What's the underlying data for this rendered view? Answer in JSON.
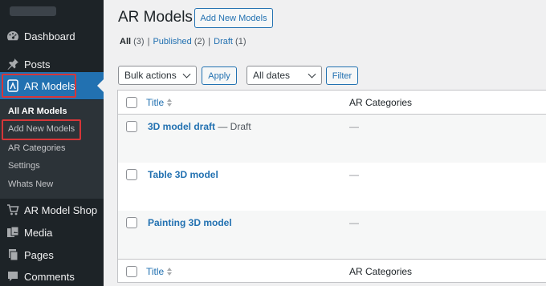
{
  "sidebar": {
    "items": [
      {
        "label": "Dashboard",
        "icon": "dashboard-icon"
      },
      {
        "label": "Posts",
        "icon": "pushpin-icon"
      },
      {
        "label": "AR Models",
        "icon": "ar-model-icon"
      },
      {
        "label": "AR Model Shop",
        "icon": "cart-icon"
      },
      {
        "label": "Media",
        "icon": "media-icon"
      },
      {
        "label": "Pages",
        "icon": "pages-icon"
      },
      {
        "label": "Comments",
        "icon": "comments-icon"
      }
    ],
    "submenu": [
      "All AR Models",
      "Add New Models",
      "AR Categories",
      "Settings",
      "Whats New"
    ]
  },
  "header": {
    "title": "AR Models",
    "add_new_label": "Add New Models"
  },
  "views": {
    "all_label": "All",
    "all_count": "(3)",
    "published_label": "Published",
    "published_count": "(2)",
    "draft_label": "Draft",
    "draft_count": "(1)",
    "separator": "|"
  },
  "filters": {
    "bulk_actions": "Bulk actions",
    "apply_label": "Apply",
    "dates": "All dates",
    "filter_label": "Filter"
  },
  "table": {
    "columns": [
      "Title",
      "AR Categories"
    ],
    "rows": [
      {
        "title": "3D model draft",
        "state": " — Draft",
        "category": "—"
      },
      {
        "title": "Table 3D model",
        "state": "",
        "category": "—"
      },
      {
        "title": "Painting 3D model",
        "state": "",
        "category": "—"
      }
    ]
  },
  "colors": {
    "sidebar_bg": "#1d2327",
    "accent": "#2271b1",
    "highlight": "#d63638"
  }
}
